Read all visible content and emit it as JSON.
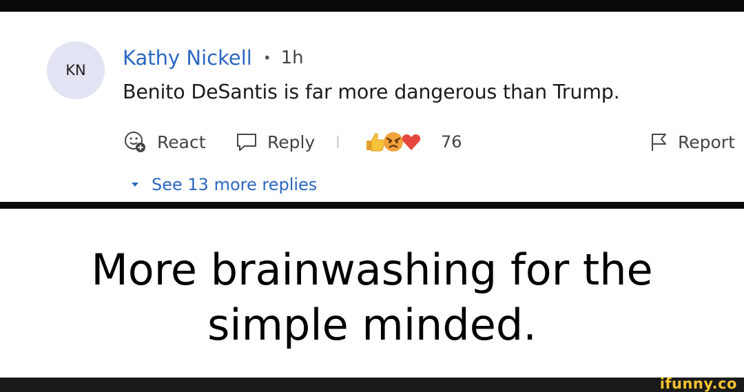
{
  "comment": {
    "avatar_initials": "KN",
    "author": "Kathy Nickell",
    "separator": "•",
    "time": "1h",
    "text": "Benito DeSantis is far more dangerous than Trump."
  },
  "actions": {
    "react_label": "React",
    "reply_label": "Reply",
    "reaction_icons": [
      "thumbs-up",
      "angry-face",
      "heart"
    ],
    "reaction_count": "76",
    "report_label": "Report"
  },
  "replies": {
    "see_more_label": "See 13 more replies"
  },
  "caption": {
    "line1": "More brainwashing for the",
    "line2": "simple minded."
  },
  "watermark": "ifunny.co",
  "colors": {
    "link_blue": "#2a67c2",
    "avatar_bg": "#e2e3f3",
    "watermark_yellow": "#f4c430"
  }
}
